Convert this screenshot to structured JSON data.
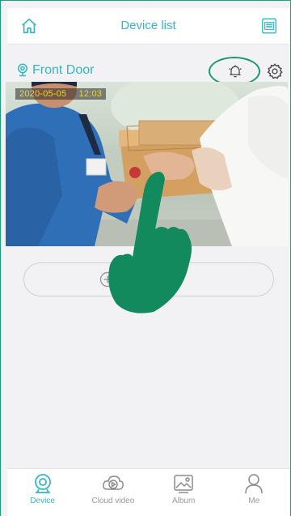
{
  "header": {
    "title": "Device list",
    "home_icon": "home-icon",
    "qr_icon": "qr-code-icon"
  },
  "device": {
    "name": "Front Door",
    "location_icon": "location-pin-icon",
    "bell_icon": "alarm-bell-icon",
    "settings_icon": "gear-icon",
    "preview": {
      "date": "2020-05-05",
      "time": "12:03"
    }
  },
  "add_device": {
    "label": "Add device",
    "visible_label": "evice",
    "icon": "plus-circle-icon"
  },
  "tabs": [
    {
      "label": "Device",
      "icon": "camera-icon",
      "active": true
    },
    {
      "label": "Cloud video",
      "icon": "cloud-play-icon",
      "active": false
    },
    {
      "label": "Album",
      "icon": "image-icon",
      "active": false
    },
    {
      "label": "Me",
      "icon": "person-icon",
      "active": false
    }
  ],
  "colors": {
    "accent": "#30b8c5",
    "annotation": "#1a9a6e",
    "timestamp": "#f2d23a"
  }
}
